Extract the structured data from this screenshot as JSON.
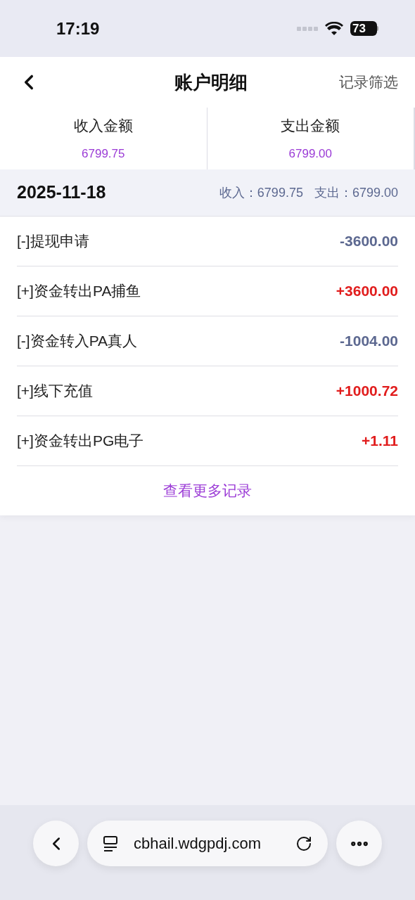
{
  "status_bar": {
    "time": "17:19",
    "battery": "73"
  },
  "header": {
    "title": "账户明细",
    "action": "记录筛选"
  },
  "summary": [
    {
      "label": "收入金额",
      "value": "6799.75"
    },
    {
      "label": "支出金额",
      "value": "6799.00"
    }
  ],
  "day": {
    "date": "2025-11-18",
    "income_label": "收入：",
    "income": "6799.75",
    "expense_label": "支出：",
    "expense": "6799.00"
  },
  "records": [
    {
      "title": "[-]提现申请",
      "amount": "-3600.00",
      "kind": "out"
    },
    {
      "title": "[+]资金转出PA捕鱼",
      "amount": "+3600.00",
      "kind": "in"
    },
    {
      "title": "[-]资金转入PA真人",
      "amount": "-1004.00",
      "kind": "out"
    },
    {
      "title": "[+]线下充值",
      "amount": "+1000.72",
      "kind": "in"
    },
    {
      "title": "[+]资金转出PG电子",
      "amount": "+1.11",
      "kind": "in"
    }
  ],
  "more_link": "查看更多记录",
  "browser": {
    "url": "cbhail.wdgpdj.com"
  }
}
